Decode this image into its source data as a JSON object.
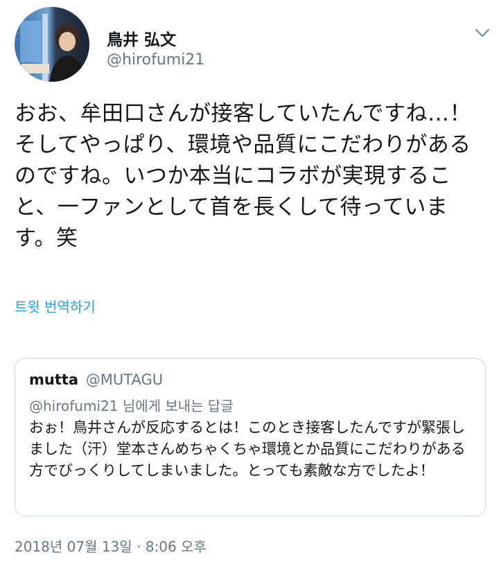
{
  "author": {
    "display_name": "鳥井 弘文",
    "handle": "@hirofumi21",
    "avatar_icon": "avatar-photo"
  },
  "menu_icon": "chevron-down-icon",
  "tweet": {
    "text": "おお、牟田口さんが接客していたんですね…！そしてやっぱり、環境や品質にこだわりがあるのですね。いつか本当にコラボが実現すること、一ファンとして首を長くして待っています。笑",
    "translate_label": "트윗 번역하기"
  },
  "quoted_tweet": {
    "name": "mutta",
    "handle": "@MUTAGU",
    "reply_context": "@hirofumi21 님에게 보내는 답글",
    "text": "おぉ！鳥井さんが反応するとは！このとき接客したんですが緊張しました（汗）堂本さんめちゃくちゃ環境とか品質にこだわりがある方でびっくりしてしまいました。とっても素敵な方でしたよ！"
  },
  "timestamp": "2018년 07월 13일 · 8:06 오후",
  "colors": {
    "link": "#1da1f2",
    "secondary_text": "#657786",
    "border": "#ccd6dd"
  }
}
